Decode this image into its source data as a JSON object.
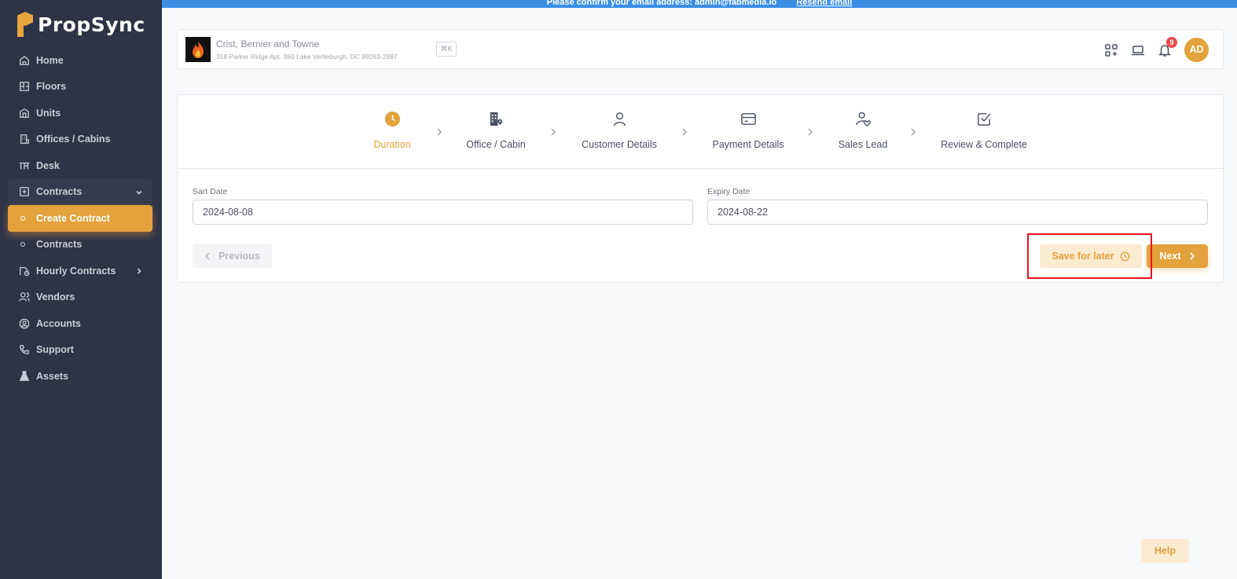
{
  "brand": {
    "name": "PropSync",
    "accent": "#e3a23b",
    "sidebar_bg": "#2e3348"
  },
  "banner": {
    "text": "Please confirm your email address: admin@fabmedia.io",
    "link": "Resend email"
  },
  "sidebar": {
    "items": [
      {
        "label": "Home",
        "icon": "home-icon"
      },
      {
        "label": "Floors",
        "icon": "floor-plan-icon"
      },
      {
        "label": "Units",
        "icon": "units-icon"
      },
      {
        "label": "Offices / Cabins",
        "icon": "building-icon"
      },
      {
        "label": "Desk",
        "icon": "desk-icon"
      },
      {
        "label": "Contracts",
        "icon": "contracts-icon"
      },
      {
        "label": "Create Contract"
      },
      {
        "label": "Contracts"
      },
      {
        "label": "Hourly Contracts",
        "icon": "hourly-contracts-icon"
      },
      {
        "label": "Vendors",
        "icon": "vendors-icon"
      },
      {
        "label": "Accounts",
        "icon": "accounts-icon"
      },
      {
        "label": "Support",
        "icon": "phone-icon"
      },
      {
        "label": "Assets",
        "icon": "flask-icon"
      }
    ]
  },
  "header": {
    "company_name": "Crist, Bernier and Towne",
    "company_address": "318 Parker Ridge Apt. 360 Lake Verlieburgh, DC 99263-2887",
    "shortcut": "⌘K",
    "notification_count": "9",
    "avatar_initials": "AD"
  },
  "steps": [
    {
      "label": "Duration",
      "icon": "clock-icon",
      "active": true
    },
    {
      "label": "Office / Cabin",
      "icon": "building-icon"
    },
    {
      "label": "Customer Details",
      "icon": "user-icon"
    },
    {
      "label": "Payment Details",
      "icon": "card-icon"
    },
    {
      "label": "Sales Lead",
      "icon": "user-heart-icon"
    },
    {
      "label": "Review & Complete",
      "icon": "checkbox-icon"
    }
  ],
  "form": {
    "start_date_label": "Sart Date",
    "start_date_value": "2024-08-08",
    "expiry_date_label": "Expiry Date",
    "expiry_date_value": "2024-08-22"
  },
  "actions": {
    "previous": "Previous",
    "save_later": "Save for later",
    "next": "Next"
  },
  "help": "Help"
}
